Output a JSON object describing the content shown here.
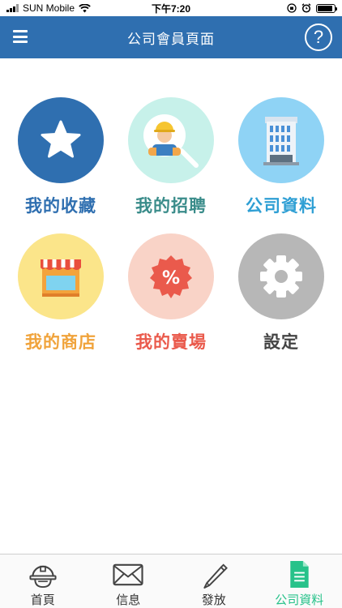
{
  "status_bar": {
    "carrier": "SUN Mobile",
    "time": "下午7:20"
  },
  "header": {
    "title": "公司會員頁面",
    "help_label": "?"
  },
  "tiles": [
    {
      "label": "我的收藏",
      "icon": "star-icon",
      "circle_color": "#2f6fb0",
      "label_color": "#2f6fb0"
    },
    {
      "label": "我的招聘",
      "icon": "worker-search-icon",
      "circle_color": "#c7f1ea",
      "label_color": "#3a8c8a"
    },
    {
      "label": "公司資料",
      "icon": "building-icon",
      "circle_color": "#8fd3f5",
      "label_color": "#2f9fd4"
    },
    {
      "label": "我的商店",
      "icon": "shop-icon",
      "circle_color": "#fbe58a",
      "label_color": "#f0a33b"
    },
    {
      "label": "我的賣場",
      "icon": "discount-badge-icon",
      "circle_color": "#f9d3c7",
      "label_color": "#ea5a4c"
    },
    {
      "label": "設定",
      "icon": "gear-icon",
      "circle_color": "#b7b7b7",
      "label_color": "#444444"
    }
  ],
  "discount_symbol": "%",
  "bottom_nav": {
    "items": [
      {
        "label": "首頁",
        "icon": "helmet-icon"
      },
      {
        "label": "信息",
        "icon": "envelope-icon"
      },
      {
        "label": "發放",
        "icon": "pencil-icon"
      },
      {
        "label": "公司資料",
        "icon": "document-icon",
        "active": true
      }
    ],
    "active_color": "#27c28a"
  }
}
